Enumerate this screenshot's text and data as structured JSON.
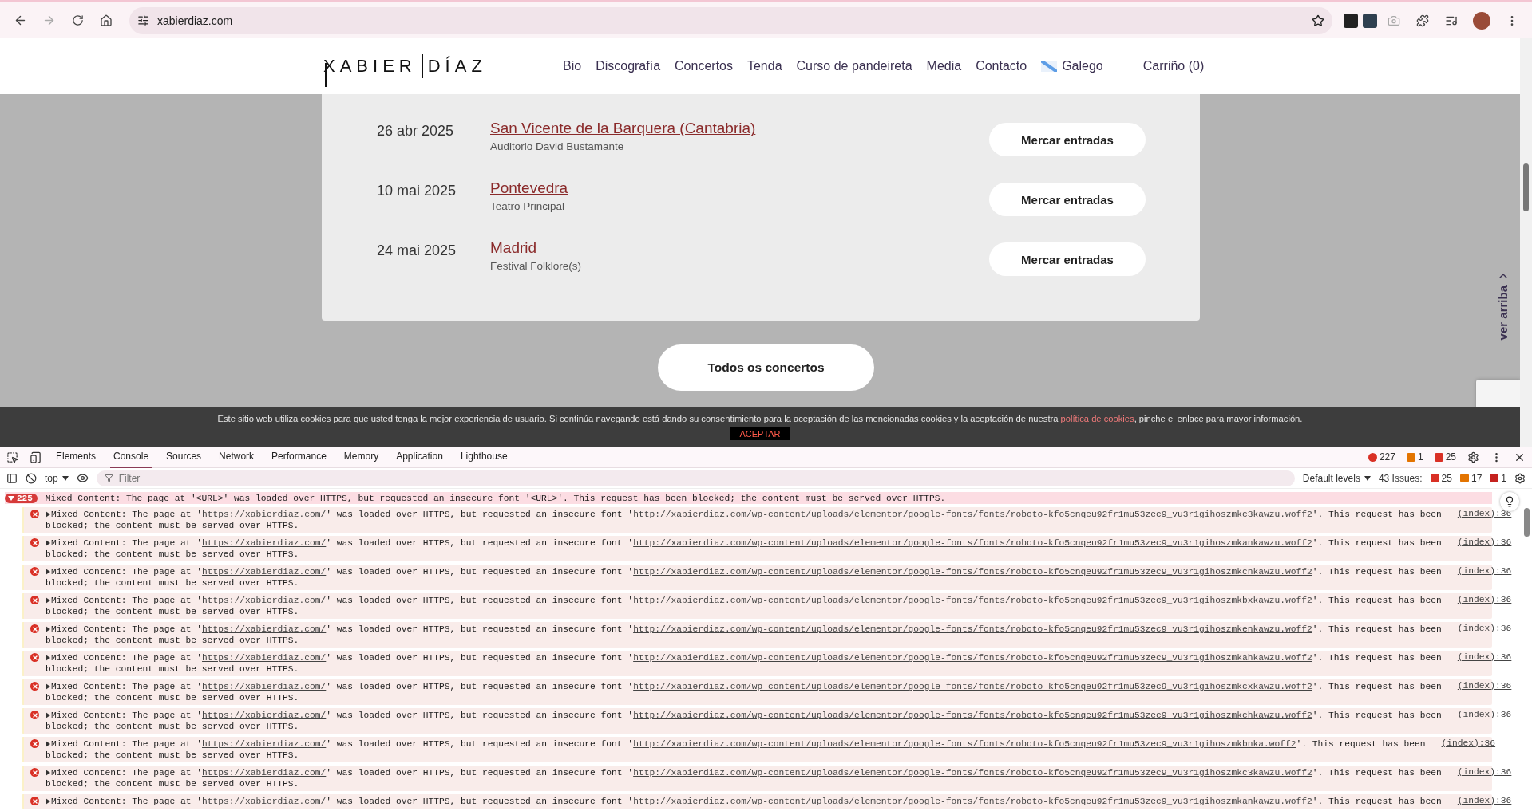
{
  "browser": {
    "url": "xabierdiaz.com"
  },
  "site": {
    "logo": [
      "XABIER",
      "DÍAZ"
    ],
    "nav": [
      "Bio",
      "Discografía",
      "Concertos",
      "Tenda",
      "Curso de pandeireta",
      "Media",
      "Contacto"
    ],
    "language": "Galego",
    "cart": "Carriño (0)",
    "concerts": [
      {
        "date": "26 abr 2025",
        "city": "San Vicente de la Barquera (Cantabria)",
        "venue": "Auditorio David Bustamante",
        "button": "Mercar entradas"
      },
      {
        "date": "10 mai 2025",
        "city": "Pontevedra",
        "venue": "Teatro Principal",
        "button": "Mercar entradas"
      },
      {
        "date": "24 mai 2025",
        "city": "Madrid",
        "venue": "Festival Folklore(s)",
        "button": "Mercar entradas"
      }
    ],
    "all_button": "Todos os concertos",
    "back_to_top": "ver arriba",
    "cookie": {
      "before": "Este sitio web utiliza cookies para que usted tenga la mejor experiencia de usuario. Si continúa navegando está dando su consentimiento para la aceptación de las mencionadas cookies y la aceptación de nuestra",
      "link": "política de cookies",
      "after": ", pinche el enlace para mayor información.",
      "button": "ACEPTAR"
    }
  },
  "devtools": {
    "tabs": [
      {
        "label": "Elements",
        "selected": false
      },
      {
        "label": "Console",
        "selected": true
      },
      {
        "label": "Sources",
        "selected": false
      },
      {
        "label": "Network",
        "selected": false
      },
      {
        "label": "Performance",
        "selected": false
      },
      {
        "label": "Memory",
        "selected": false
      },
      {
        "label": "Application",
        "selected": false
      },
      {
        "label": "Lighthouse",
        "selected": false
      }
    ],
    "counts": {
      "errors": "227",
      "warnings": "1",
      "issues": "25"
    },
    "context": "top",
    "filter_placeholder": "Filter",
    "levels": "Default levels",
    "issues": {
      "label": "43 Issues:",
      "errors": "25",
      "warnings": "17",
      "info": "1"
    },
    "group": {
      "count": "225",
      "text": "Mixed Content: The page at '<URL>' was loaded over HTTPS, but requested an insecure font '<URL>'. This request has been blocked; the content must be served over HTTPS."
    },
    "messages": [
      {
        "a": "Mixed Content: The page at '",
        "page": "https://xabierdiaz.com/",
        "b": "' was loaded over HTTPS, but requested an insecure font '",
        "font": "http://xabierdiaz.com/wp-content/uploads/elementor/google-fonts/fonts/roboto-kfo5cnqeu92fr1mu53zec9_vu3r1gihoszmkc3kawzu.woff2",
        "c": "'. This request has been",
        "line2": "blocked; the content must be served over HTTPS.",
        "source": "(index):36"
      },
      {
        "a": "Mixed Content: The page at '",
        "page": "https://xabierdiaz.com/",
        "b": "' was loaded over HTTPS, but requested an insecure font '",
        "font": "http://xabierdiaz.com/wp-content/uploads/elementor/google-fonts/fonts/roboto-kfo5cnqeu92fr1mu53zec9_vu3r1gihoszmkankawzu.woff2",
        "c": "'. This request has been",
        "line2": "blocked; the content must be served over HTTPS.",
        "source": "(index):36"
      },
      {
        "a": "Mixed Content: The page at '",
        "page": "https://xabierdiaz.com/",
        "b": "' was loaded over HTTPS, but requested an insecure font '",
        "font": "http://xabierdiaz.com/wp-content/uploads/elementor/google-fonts/fonts/roboto-kfo5cnqeu92fr1mu53zec9_vu3r1gihoszmkcnkawzu.woff2",
        "c": "'. This request has been",
        "line2": "blocked; the content must be served over HTTPS.",
        "source": "(index):36"
      },
      {
        "a": "Mixed Content: The page at '",
        "page": "https://xabierdiaz.com/",
        "b": "' was loaded over HTTPS, but requested an insecure font '",
        "font": "http://xabierdiaz.com/wp-content/uploads/elementor/google-fonts/fonts/roboto-kfo5cnqeu92fr1mu53zec9_vu3r1gihoszmkbxkawzu.woff2",
        "c": "'. This request has been",
        "line2": "blocked; the content must be served over HTTPS.",
        "source": "(index):36"
      },
      {
        "a": "Mixed Content: The page at '",
        "page": "https://xabierdiaz.com/",
        "b": "' was loaded over HTTPS, but requested an insecure font '",
        "font": "http://xabierdiaz.com/wp-content/uploads/elementor/google-fonts/fonts/roboto-kfo5cnqeu92fr1mu53zec9_vu3r1gihoszmkenkawzu.woff2",
        "c": "'. This request has been",
        "line2": "blocked; the content must be served over HTTPS.",
        "source": "(index):36"
      },
      {
        "a": "Mixed Content: The page at '",
        "page": "https://xabierdiaz.com/",
        "b": "' was loaded over HTTPS, but requested an insecure font '",
        "font": "http://xabierdiaz.com/wp-content/uploads/elementor/google-fonts/fonts/roboto-kfo5cnqeu92fr1mu53zec9_vu3r1gihoszmkahkawzu.woff2",
        "c": "'. This request has been",
        "line2": "blocked; the content must be served over HTTPS.",
        "source": "(index):36"
      },
      {
        "a": "Mixed Content: The page at '",
        "page": "https://xabierdiaz.com/",
        "b": "' was loaded over HTTPS, but requested an insecure font '",
        "font": "http://xabierdiaz.com/wp-content/uploads/elementor/google-fonts/fonts/roboto-kfo5cnqeu92fr1mu53zec9_vu3r1gihoszmkcxkawzu.woff2",
        "c": "'. This request has been",
        "line2": "blocked; the content must be served over HTTPS.",
        "source": "(index):36"
      },
      {
        "a": "Mixed Content: The page at '",
        "page": "https://xabierdiaz.com/",
        "b": "' was loaded over HTTPS, but requested an insecure font '",
        "font": "http://xabierdiaz.com/wp-content/uploads/elementor/google-fonts/fonts/roboto-kfo5cnqeu92fr1mu53zec9_vu3r1gihoszmkchkawzu.woff2",
        "c": "'. This request has been",
        "line2": "blocked; the content must be served over HTTPS.",
        "source": "(index):36"
      },
      {
        "a": "Mixed Content: The page at '",
        "page": "https://xabierdiaz.com/",
        "b": "' was loaded over HTTPS, but requested an insecure font '",
        "font": "http://xabierdiaz.com/wp-content/uploads/elementor/google-fonts/fonts/roboto-kfo5cnqeu92fr1mu53zec9_vu3r1gihoszmkbnka.woff2",
        "c": "'. This request has been",
        "line2": "blocked; the content must be served over HTTPS.",
        "source": "(index):36"
      },
      {
        "a": "Mixed Content: The page at '",
        "page": "https://xabierdiaz.com/",
        "b": "' was loaded over HTTPS, but requested an insecure font '",
        "font": "http://xabierdiaz.com/wp-content/uploads/elementor/google-fonts/fonts/roboto-kfo5cnqeu92fr1mu53zec9_vu3r1gihoszmkc3kawzu.woff2",
        "c": "'. This request has been",
        "line2": "blocked; the content must be served over HTTPS.",
        "source": "(index):36"
      },
      {
        "a": "Mixed Content: The page at '",
        "page": "https://xabierdiaz.com/",
        "b": "' was loaded over HTTPS, but requested an insecure font '",
        "font": "http://xabierdiaz.com/wp-content/uploads/elementor/google-fonts/fonts/roboto-kfo5cnqeu92fr1mu53zec9_vu3r1gihoszmkankawzu.woff2",
        "c": "'. This request has been",
        "source": "(index):36"
      }
    ]
  }
}
